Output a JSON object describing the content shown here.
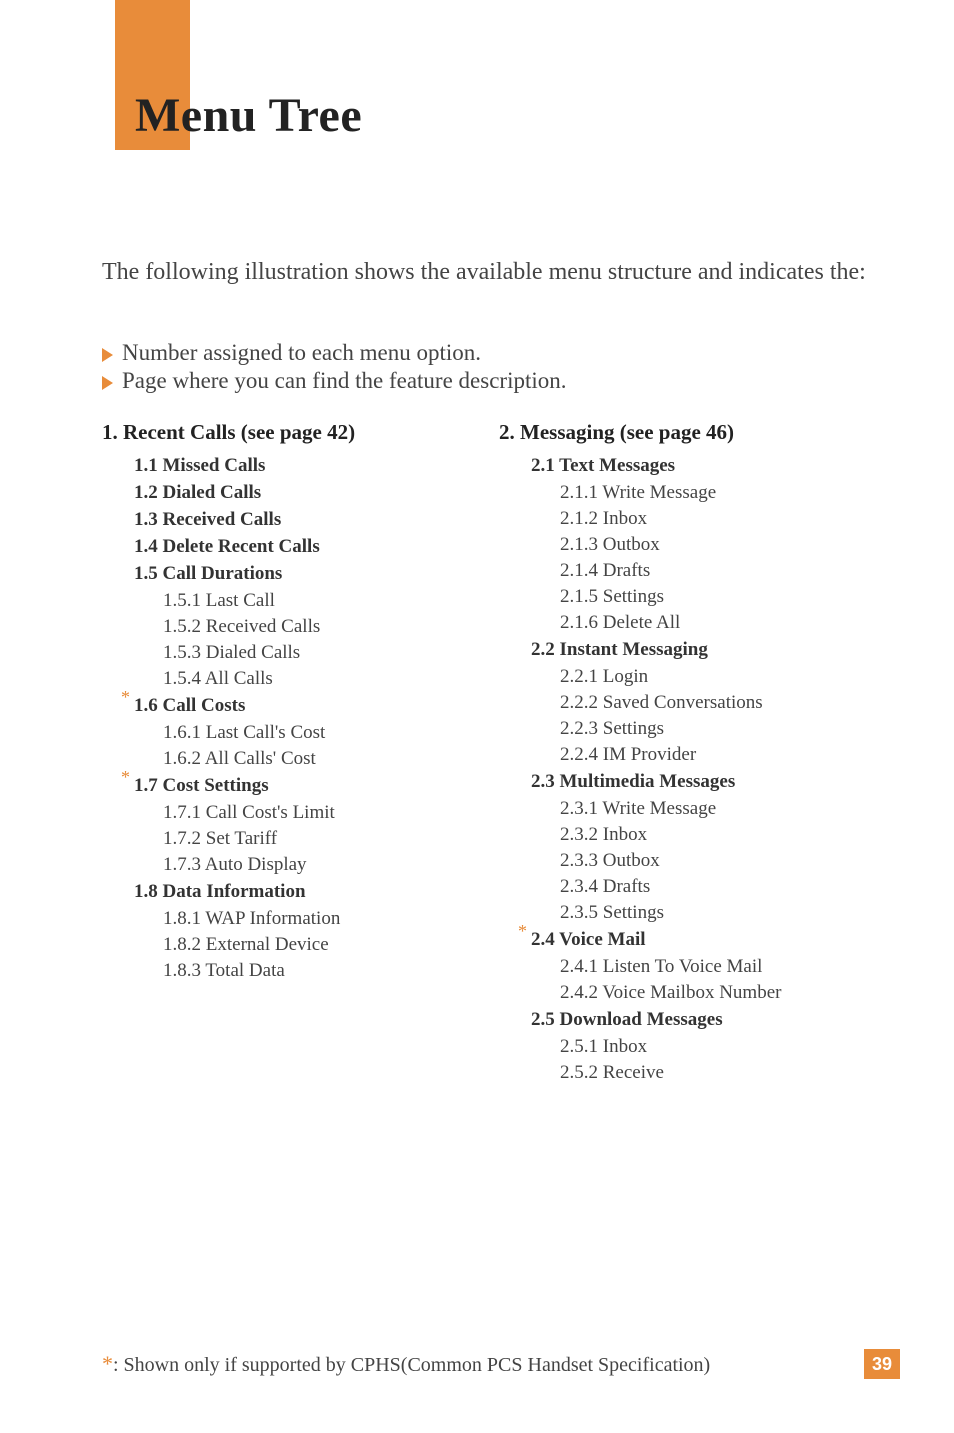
{
  "title": "Menu Tree",
  "intro": "The following illustration shows the available menu structure and indicates the:",
  "bullets": [
    "Number assigned to each menu option.",
    "Page where you can find the feature description."
  ],
  "left": {
    "h": "1.  Recent Calls (see page 42)",
    "s11": "1.1 Missed Calls",
    "s12": "1.2 Dialed Calls",
    "s13": "1.3 Received Calls",
    "s14": "1.4 Delete Recent Calls",
    "s15": "1.5 Call Durations",
    "s151": "1.5.1 Last Call",
    "s152": "1.5.2 Received Calls",
    "s153": "1.5.3 Dialed Calls",
    "s154": "1.5.4 All Calls",
    "s16": "1.6 Call Costs",
    "s161": "1.6.1 Last Call's Cost",
    "s162": "1.6.2 All Calls' Cost",
    "s17": "1.7 Cost Settings",
    "s171": "1.7.1 Call Cost's Limit",
    "s172": "1.7.2 Set Tariff",
    "s173": "1.7.3 Auto Display",
    "s18": "1.8 Data Information",
    "s181": "1.8.1 WAP Information",
    "s182": "1.8.2 External Device",
    "s183": "1.8.3 Total Data"
  },
  "right": {
    "h": "2.  Messaging (see page 46)",
    "s21": "2.1 Text Messages",
    "s211": "2.1.1 Write Message",
    "s212": "2.1.2 Inbox",
    "s213": "2.1.3 Outbox",
    "s214": "2.1.4 Drafts",
    "s215": "2.1.5 Settings",
    "s216": "2.1.6 Delete All",
    "s22": "2.2 Instant Messaging",
    "s221": "2.2.1 Login",
    "s222": "2.2.2 Saved Conversations",
    "s223": "2.2.3 Settings",
    "s224": "2.2.4 IM Provider",
    "s23": "2.3 Multimedia Messages",
    "s231": "2.3.1 Write Message",
    "s232": "2.3.2 Inbox",
    "s233": "2.3.3 Outbox",
    "s234": "2.3.4 Drafts",
    "s235": "2.3.5 Settings",
    "s24": "2.4 Voice Mail",
    "s241": "2.4.1 Listen To Voice Mail",
    "s242": "2.4.2 Voice Mailbox Number",
    "s25": "2.5 Download Messages",
    "s251": "2.5.1 Inbox",
    "s252": "2.5.2 Receive"
  },
  "footer": ": Shown only if supported by CPHS(Common PCS Handset Specification)",
  "pagenum": "39",
  "star": "*"
}
